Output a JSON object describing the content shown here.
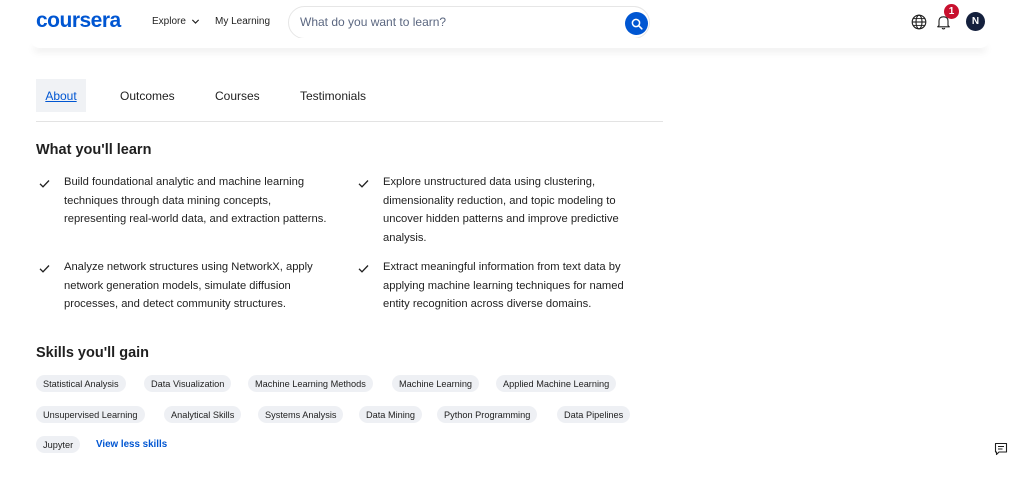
{
  "header": {
    "logo": "coursera",
    "explore": "Explore",
    "my_learning": "My Learning",
    "search_placeholder": "What do you want to learn?",
    "notification_count": "1",
    "avatar_initial": "N"
  },
  "tabs": [
    {
      "label": "About",
      "active": true
    },
    {
      "label": "Outcomes",
      "active": false
    },
    {
      "label": "Courses",
      "active": false
    },
    {
      "label": "Testimonials",
      "active": false
    }
  ],
  "learn": {
    "title": "What you'll learn",
    "items": [
      "Build foundational analytic and machine learning techniques through data mining concepts, representing real-world data, and extraction patterns.",
      "Explore unstructured data using clustering, dimensionality reduction, and topic modeling to uncover hidden patterns and improve predictive analysis.",
      "Analyze network structures using NetworkX, apply network generation models, simulate diffusion processes, and detect community structures.",
      "Extract meaningful information from text data by applying machine learning techniques for named entity recognition across diverse domains."
    ]
  },
  "skills": {
    "title": "Skills you'll gain",
    "chips": [
      "Statistical Analysis",
      "Data Visualization",
      "Machine Learning Methods",
      "Machine Learning",
      "Applied Machine Learning",
      "Unsupervised Learning",
      "Analytical Skills",
      "Systems Analysis",
      "Data Mining",
      "Python Programming",
      "Data Pipelines",
      "Jupyter"
    ],
    "view_less": "View less skills"
  },
  "colors": {
    "brand": "#0056d2",
    "badge": "#c8102e",
    "avatar": "#14203d",
    "chip_bg": "#eef0f4"
  }
}
